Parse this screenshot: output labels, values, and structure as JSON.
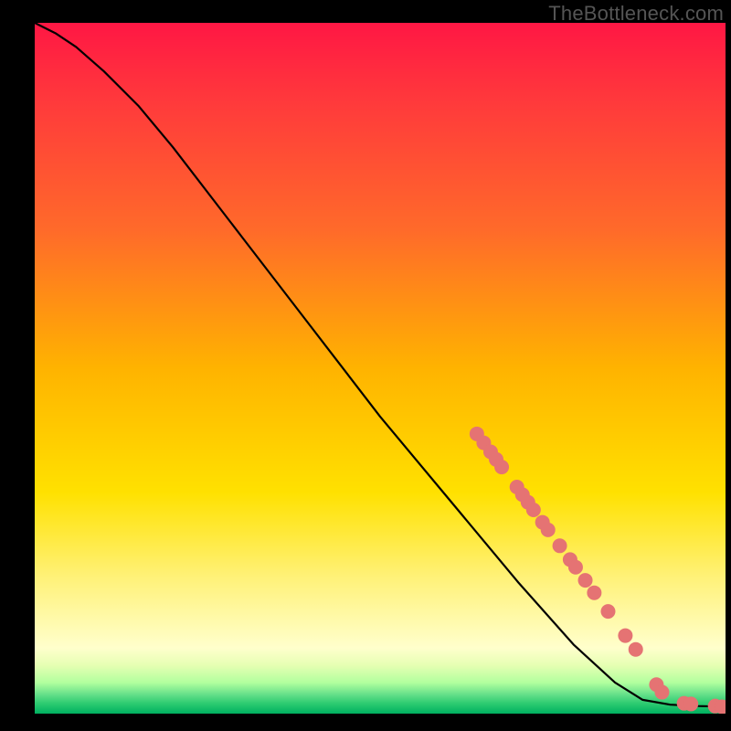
{
  "watermark": "TheBottleneck.com",
  "chart_data": {
    "type": "line",
    "title": "",
    "xlabel": "",
    "ylabel": "",
    "xlim": [
      0,
      100
    ],
    "ylim": [
      0,
      100
    ],
    "gradient_stops": [
      {
        "offset": 0.0,
        "color": "#ff1744"
      },
      {
        "offset": 0.12,
        "color": "#ff3b3b"
      },
      {
        "offset": 0.3,
        "color": "#ff6a2a"
      },
      {
        "offset": 0.5,
        "color": "#ffb300"
      },
      {
        "offset": 0.68,
        "color": "#ffe100"
      },
      {
        "offset": 0.8,
        "color": "#fff176"
      },
      {
        "offset": 0.905,
        "color": "#ffffcc"
      },
      {
        "offset": 0.93,
        "color": "#e6ffb3"
      },
      {
        "offset": 0.955,
        "color": "#b2ff9e"
      },
      {
        "offset": 0.972,
        "color": "#66e08a"
      },
      {
        "offset": 0.985,
        "color": "#2ecc71"
      },
      {
        "offset": 1.0,
        "color": "#00b060"
      }
    ],
    "series": [
      {
        "name": "curve",
        "stroke": "#000000",
        "stroke_width": 2.2,
        "points": [
          {
            "x": 0.0,
            "y": 100.0
          },
          {
            "x": 3.0,
            "y": 98.5
          },
          {
            "x": 6.0,
            "y": 96.5
          },
          {
            "x": 10.0,
            "y": 93.0
          },
          {
            "x": 15.0,
            "y": 88.0
          },
          {
            "x": 20.0,
            "y": 82.0
          },
          {
            "x": 30.0,
            "y": 69.0
          },
          {
            "x": 40.0,
            "y": 56.0
          },
          {
            "x": 50.0,
            "y": 43.0
          },
          {
            "x": 60.0,
            "y": 31.0
          },
          {
            "x": 70.0,
            "y": 19.0
          },
          {
            "x": 78.0,
            "y": 10.0
          },
          {
            "x": 84.0,
            "y": 4.5
          },
          {
            "x": 88.0,
            "y": 2.0
          },
          {
            "x": 92.0,
            "y": 1.3
          },
          {
            "x": 96.0,
            "y": 1.1
          },
          {
            "x": 100.0,
            "y": 1.0
          }
        ]
      }
    ],
    "markers": {
      "name": "dots",
      "fill": "#e57373",
      "radius": 8,
      "points": [
        {
          "x": 64.0,
          "y": 40.5
        },
        {
          "x": 65.0,
          "y": 39.2
        },
        {
          "x": 66.0,
          "y": 37.9
        },
        {
          "x": 66.8,
          "y": 36.8
        },
        {
          "x": 67.6,
          "y": 35.7
        },
        {
          "x": 69.8,
          "y": 32.8
        },
        {
          "x": 70.6,
          "y": 31.7
        },
        {
          "x": 71.4,
          "y": 30.6
        },
        {
          "x": 72.2,
          "y": 29.5
        },
        {
          "x": 73.5,
          "y": 27.7
        },
        {
          "x": 74.3,
          "y": 26.6
        },
        {
          "x": 76.0,
          "y": 24.3
        },
        {
          "x": 77.5,
          "y": 22.3
        },
        {
          "x": 78.3,
          "y": 21.2
        },
        {
          "x": 79.7,
          "y": 19.3
        },
        {
          "x": 81.0,
          "y": 17.5
        },
        {
          "x": 83.0,
          "y": 14.8
        },
        {
          "x": 85.5,
          "y": 11.3
        },
        {
          "x": 87.0,
          "y": 9.3
        },
        {
          "x": 90.0,
          "y": 4.2
        },
        {
          "x": 90.8,
          "y": 3.1
        },
        {
          "x": 94.0,
          "y": 1.5
        },
        {
          "x": 95.0,
          "y": 1.4
        },
        {
          "x": 98.5,
          "y": 1.1
        },
        {
          "x": 99.5,
          "y": 1.0
        }
      ]
    }
  }
}
